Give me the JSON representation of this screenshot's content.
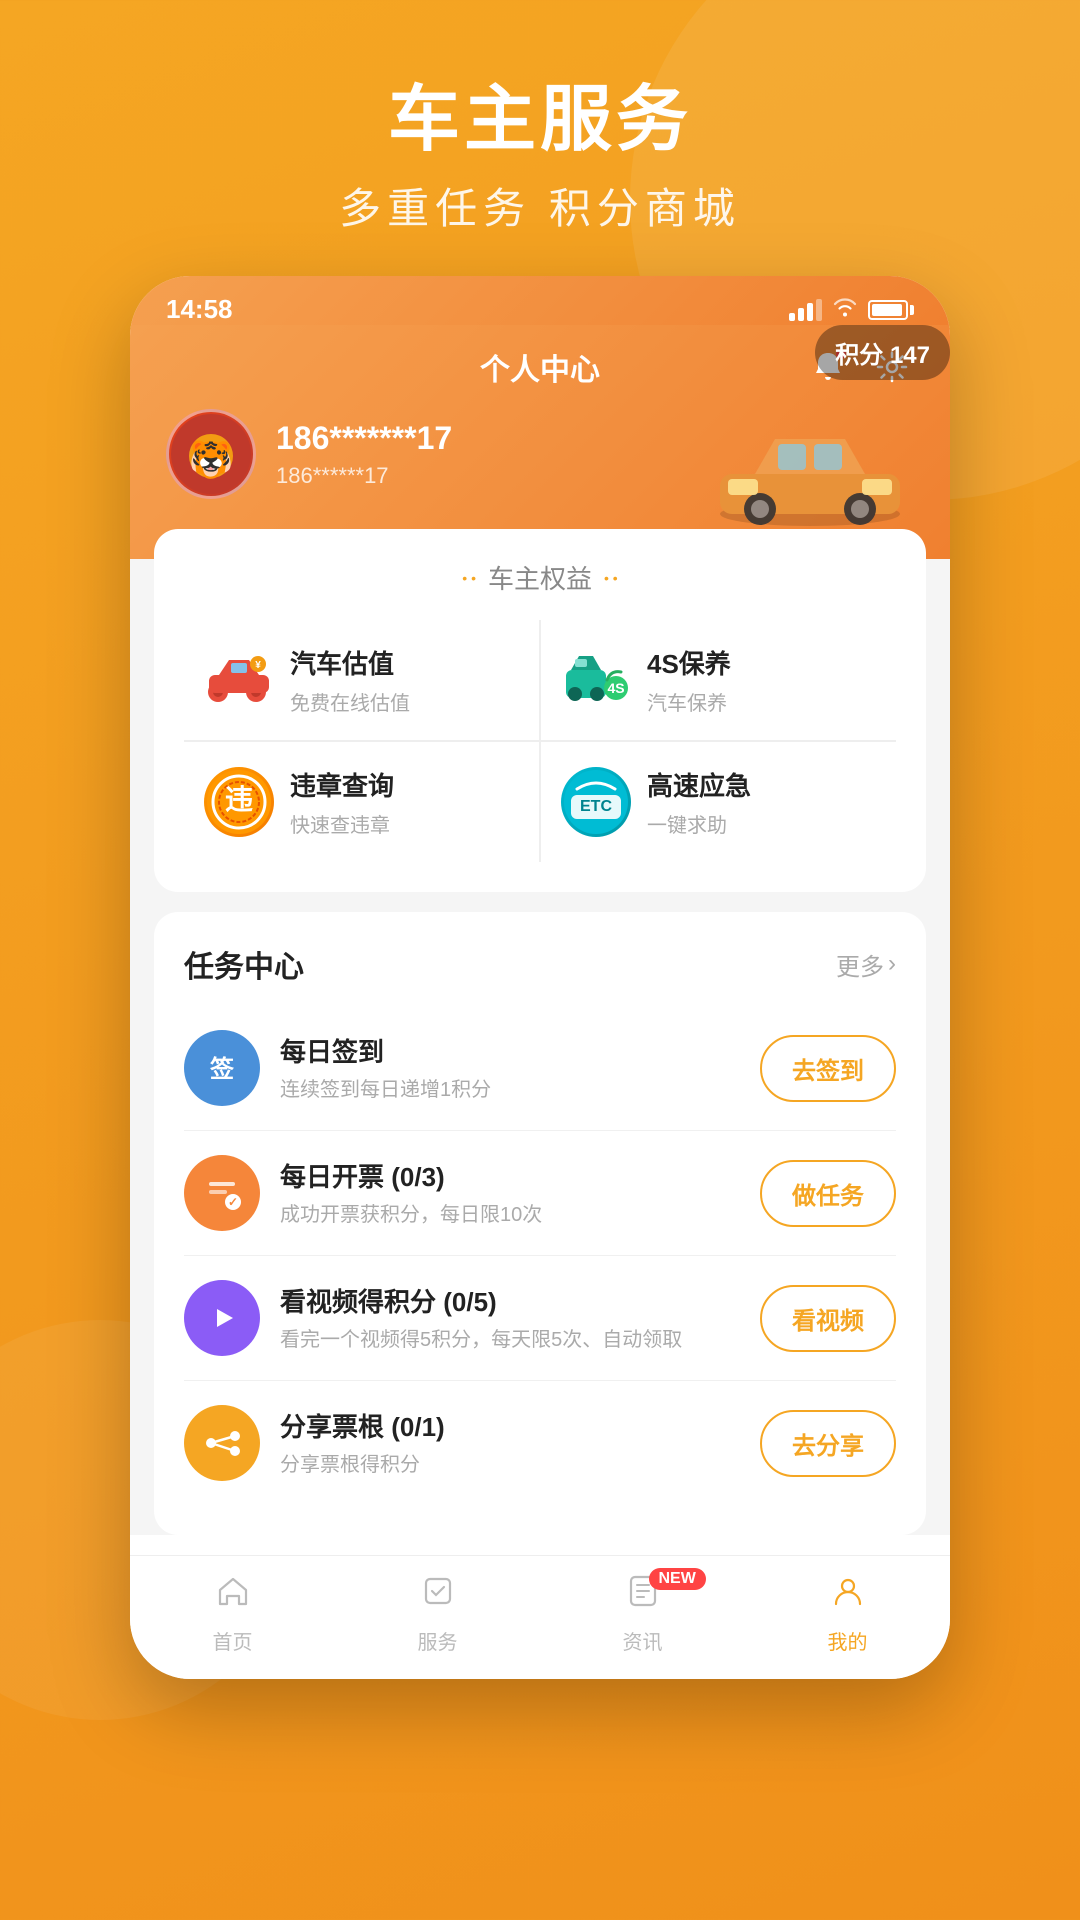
{
  "background": {
    "gradient_start": "#f5a623",
    "gradient_end": "#f0901a"
  },
  "hero": {
    "title": "车主服务",
    "subtitle": "多重任务 积分商城"
  },
  "phone": {
    "status_bar": {
      "time": "14:58"
    },
    "header": {
      "title": "个人中心",
      "bell_label": "通知",
      "settings_label": "设置"
    },
    "user": {
      "name": "186*******17",
      "sub": "186******17",
      "points_label": "积分",
      "points_value": "147",
      "points_full": "积分 147"
    },
    "car_rights": {
      "section_title": "车主权益",
      "items": [
        {
          "id": "car-valuation",
          "name": "汽车估值",
          "desc": "免费在线估值",
          "icon": "🚗"
        },
        {
          "id": "4s-service",
          "name": "4S保养",
          "desc": "汽车保养",
          "icon": "🔧"
        },
        {
          "id": "violation-query",
          "name": "违章查询",
          "desc": "快速查违章",
          "icon": "⚠️"
        },
        {
          "id": "highway-emergency",
          "name": "高速应急",
          "desc": "一键求助",
          "icon": "ETC"
        }
      ]
    },
    "task_center": {
      "title": "任务中心",
      "more_label": "更多",
      "tasks": [
        {
          "id": "daily-checkin",
          "name": "每日签到",
          "desc": "连续签到每日递增1积分",
          "btn": "去签到",
          "icon": "签",
          "icon_color": "blue"
        },
        {
          "id": "daily-open",
          "name": "每日开票 (0/3)",
          "desc": "成功开票获积分，每日限10次",
          "btn": "做任务",
          "icon": "📋",
          "icon_color": "orange"
        },
        {
          "id": "watch-video",
          "name": "看视频得积分 (0/5)",
          "desc": "看完一个视频得5积分，每天限5次、自动领取",
          "btn": "看视频",
          "icon": "▶",
          "icon_color": "purple"
        },
        {
          "id": "share-ticket",
          "name": "分享票根 (0/1)",
          "desc": "分享票根得积分",
          "btn": "去分享",
          "icon": "🔗",
          "icon_color": "amber"
        }
      ]
    },
    "bottom_nav": {
      "items": [
        {
          "id": "home",
          "label": "首页",
          "icon": "home",
          "active": false
        },
        {
          "id": "service",
          "label": "服务",
          "icon": "star",
          "active": false
        },
        {
          "id": "news",
          "label": "资讯",
          "icon": "doc",
          "active": false,
          "badge": "NEW"
        },
        {
          "id": "mine",
          "label": "我的",
          "icon": "person",
          "active": true
        }
      ]
    }
  }
}
